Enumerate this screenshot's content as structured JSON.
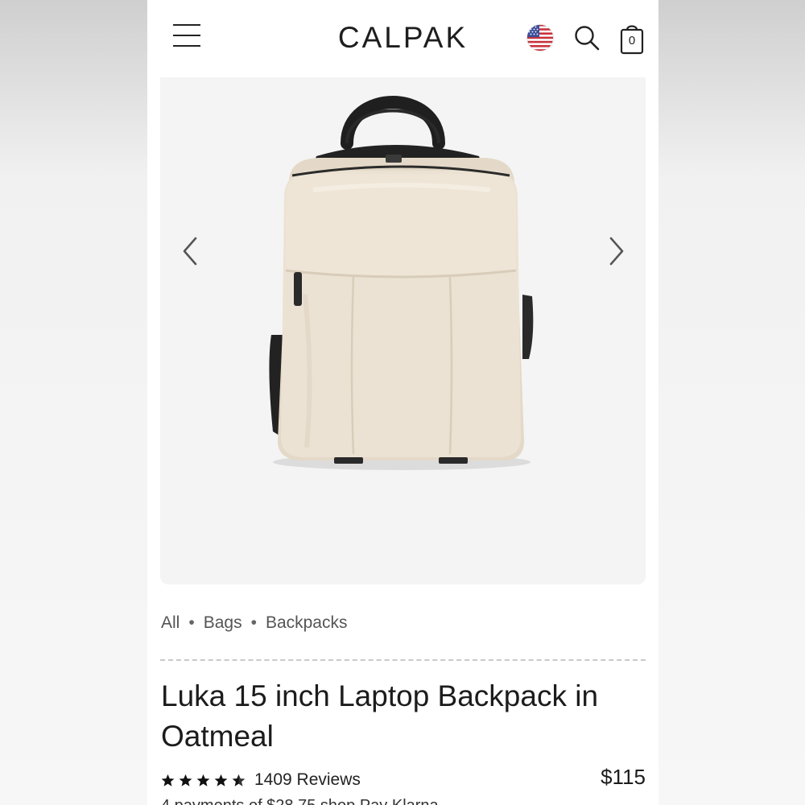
{
  "header": {
    "brand": "CALPAK",
    "cart_count": "0",
    "icons": [
      "menu-icon",
      "us-flag-icon",
      "search-icon",
      "cart-icon"
    ]
  },
  "gallery": {
    "image_alt": "Luka 15 inch Laptop Backpack in Oatmeal",
    "prev_icon": "chevron-left-icon",
    "next_icon": "chevron-right-icon"
  },
  "breadcrumb": [
    "All",
    "Bags",
    "Backpacks"
  ],
  "product": {
    "title": "Luka 15 inch Laptop Backpack in Oatmeal",
    "rating": 4.5,
    "rating_max": 5,
    "reviews": "1409 Reviews",
    "price": "$115",
    "installment_partial": "4 payments of $28.75 shop Pay  Klarna"
  },
  "colors": {
    "backpack": "#ece2d3",
    "strap": "#1f1f1f",
    "gallery_bg": "#f4f4f4",
    "text": "#1c1c1c"
  }
}
